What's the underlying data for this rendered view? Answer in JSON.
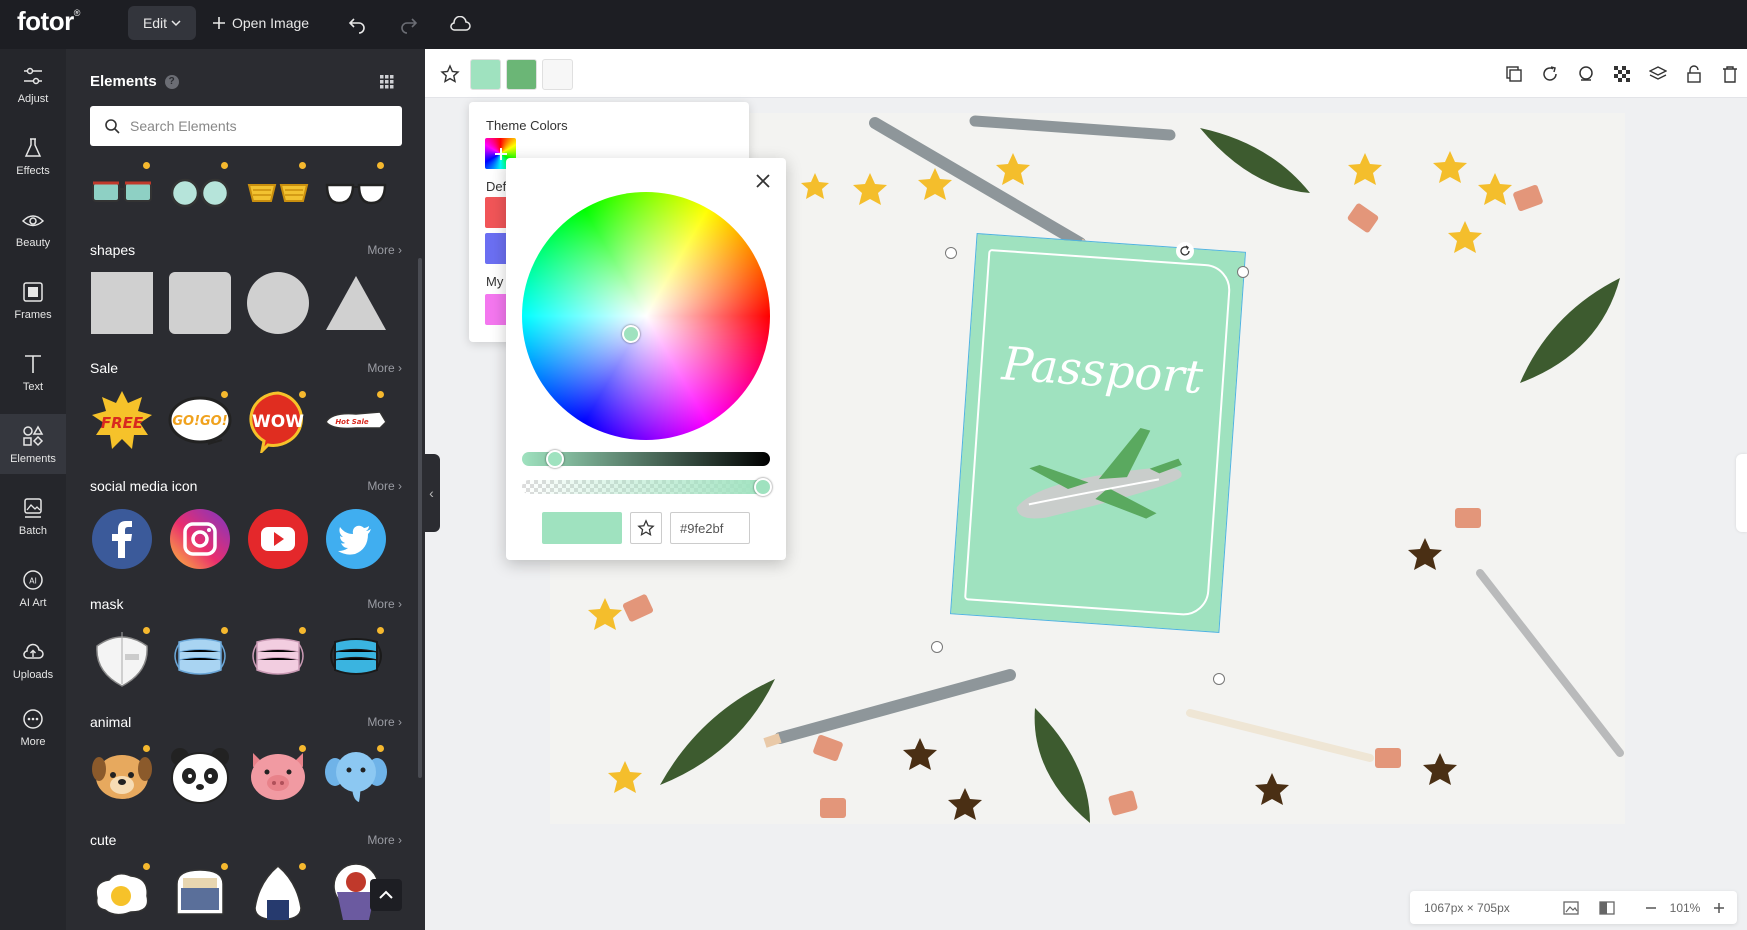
{
  "app": {
    "logo": "fotor",
    "logo_mark": "®"
  },
  "topbar": {
    "edit_label": "Edit",
    "open_label": "Open Image"
  },
  "rail": [
    {
      "label": "Adjust"
    },
    {
      "label": "Effects"
    },
    {
      "label": "Beauty"
    },
    {
      "label": "Frames"
    },
    {
      "label": "Text"
    },
    {
      "label": "Elements"
    },
    {
      "label": "Batch"
    },
    {
      "label": "AI Art"
    },
    {
      "label": "Uploads"
    },
    {
      "label": "More"
    }
  ],
  "panel": {
    "title": "Elements",
    "help": "?",
    "search_placeholder": "Search Elements",
    "more_label": "More",
    "sections": [
      {
        "label": "shapes"
      },
      {
        "label": "Sale"
      },
      {
        "label": "social media icon"
      },
      {
        "label": "mask"
      },
      {
        "label": "animal"
      },
      {
        "label": "cute"
      }
    ],
    "sale_text": [
      "FREE",
      "GO!GO!",
      "WOW",
      "Hot Sale"
    ]
  },
  "canvas": {
    "passport_text": "Passport"
  },
  "toolbar_swatches": [
    "#9fe2bf",
    "#6bb676",
    "#f7f7f7"
  ],
  "theme_popup": {
    "title": "Theme Colors",
    "default_label": "Def",
    "my_label": "My"
  },
  "picker": {
    "hex": "#9fe2bf",
    "color": "#9fe2bf"
  },
  "status": {
    "dimensions": "1067px × 705px",
    "zoom": "101%"
  }
}
